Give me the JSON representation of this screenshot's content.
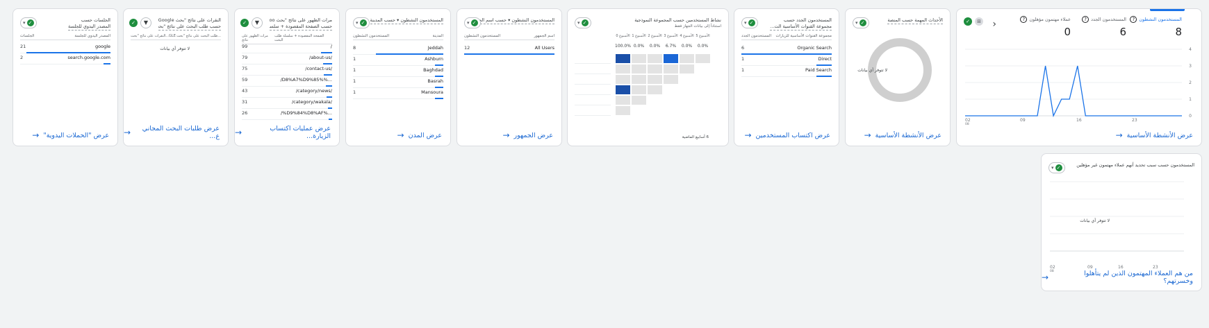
{
  "colors": {
    "accent": "#1a73e8",
    "link": "#1967d2",
    "check": "#1e8e3e",
    "heat_dark": "#1a4fa8",
    "heat_mid": "#1a66d6",
    "heat_grey": "#e3e3e3"
  },
  "overview": {
    "kpis": [
      {
        "label": "المستخدمون النشطون",
        "value": "8"
      },
      {
        "label": "المستخدمون الجدد",
        "value": "6"
      },
      {
        "label": "عملاء مهتمون مؤهلون",
        "value": "0"
      }
    ],
    "nav_prev": "‹",
    "y_ticks": [
      "4",
      "3",
      "2",
      "1",
      "0"
    ],
    "x_ticks": [
      "02",
      "09",
      "16",
      "23"
    ],
    "x_sub": "08",
    "chart_data": {
      "type": "line",
      "x": [
        "02",
        "03",
        "04",
        "05",
        "06",
        "07",
        "08",
        "09",
        "10",
        "11",
        "12",
        "13",
        "14",
        "15",
        "16",
        "17",
        "18",
        "19",
        "20",
        "21",
        "22",
        "23",
        "24",
        "25",
        "26",
        "27",
        "28",
        "29"
      ],
      "series": [
        {
          "values": [
            0,
            0,
            0,
            0,
            0,
            0,
            0,
            0,
            0,
            0,
            3,
            0,
            1,
            1,
            3,
            0,
            0,
            0,
            0,
            0,
            0,
            0,
            0,
            0,
            0,
            0,
            0,
            0
          ]
        }
      ],
      "ylim": [
        0,
        4
      ]
    },
    "footer_link": "عرض الأنشطة الأساسية"
  },
  "key_events": {
    "title": "الأحداث المهمة حسب المنصة",
    "nodata": "لا تتوفر أي بيانات",
    "footer_link": "عرض الأنشطة الأساسية"
  },
  "acquisition": {
    "title_1": "المستخدمون الجدد حسب",
    "title_2": "مجموعة القنوات الأساسية الت...",
    "col_left": "المستخدمون الجدد",
    "col_right": "مجموعة القنوات الأساسية للزيارات",
    "rows": [
      {
        "label": "Organic Search",
        "value": "6",
        "bar": 1.0
      },
      {
        "label": "Direct",
        "value": "1",
        "bar": 0.17
      },
      {
        "label": "Paid Search",
        "value": "1",
        "bar": 0.17
      }
    ],
    "footer_link": "عرض اكتساب المستخدمين"
  },
  "cohort": {
    "title": "نشاط المستخدمين حسب المجموعة النموذجية",
    "sub": "استناداً إلى بيانات الجهاز فقط",
    "headers": [
      "الأسبوع 0",
      "الأسبوع 1",
      "الأسبوع 2",
      "الأسبوع 3",
      "الأسبوع 4",
      "الأسبوع 5"
    ],
    "percents": [
      "100.0%",
      "0.0%",
      "0.0%",
      "6.7%",
      "0.0%",
      "0.0%"
    ],
    "foot_text": "6 أسابيع الماضية",
    "footer_link": ""
  },
  "audience": {
    "title": "المستخدمون النشطون ▾ حسب اسم الجمهور",
    "col_left": "المستخدمون النشطون",
    "col_right": "اسم الجمهور",
    "rows": [
      {
        "label": "All Users",
        "value": "12",
        "bar": 1.0
      }
    ],
    "footer_link": "عرض الجمهور"
  },
  "cities": {
    "title": "المستخدمون النشطون ▾ حسب المدينة",
    "col_left": "المستخدمون النشطون",
    "col_right": "المدينة",
    "rows": [
      {
        "label": "Jeddah",
        "value": "8",
        "bar": 0.8
      },
      {
        "label": "Ashburn",
        "value": "1",
        "bar": 0.1
      },
      {
        "label": "Baghdad",
        "value": "1",
        "bar": 0.1
      },
      {
        "label": "Basrah",
        "value": "1",
        "bar": 0.1
      },
      {
        "label": "Mansoura",
        "value": "1",
        "bar": 0.1
      }
    ],
    "footer_link": "عرض المدن"
  },
  "pages": {
    "title_1": "مرات الظهور على نتائج \"بحث Goo...",
    "title_2": "حسب الصفحة المقصودة + سلسلة ...",
    "col_left": "مرات الظهور على نتائج",
    "col_right": "الصفحة المقصودة + سلسلة طلب البحث",
    "rows": [
      {
        "label": "/",
        "value": "99",
        "bar": 0.12
      },
      {
        "label": "/about-us/",
        "value": "79",
        "bar": 0.1
      },
      {
        "label": "/contact-us/",
        "value": "75",
        "bar": 0.09
      },
      {
        "label": "...%D8%A7%D9%85%/",
        "value": "59",
        "bar": 0.07
      },
      {
        "label": "/category/news/",
        "value": "43",
        "bar": 0.06
      },
      {
        "label": "/category/wakala/",
        "value": "31",
        "bar": 0.05
      },
      {
        "label": "...%D9%84%D8%AF%/",
        "value": "26",
        "bar": 0.04
      }
    ],
    "footer_link": "عرض عمليات اكتساب الزيارة..."
  },
  "queries": {
    "title_1": "النقرات على نتائج \"بحث Google\"...",
    "title_2": "حسب طلب البحث على نتائج \"بحث Goo...",
    "col_left": "النقرات على نتائج \"بحث...GLE",
    "col_right": "طلب البحث على نتائج \"بحث...",
    "nodata": "لا تتوفر أي بيانات",
    "footer_link": "عرض طلبات البحث المجاني ع..."
  },
  "campaigns": {
    "title_1": "الجلسات حسب",
    "title_2": "المصدر اليدوي للجلسة",
    "col_left": "الجلسات",
    "col_right": "المصدر اليدوي للجلسة",
    "rows": [
      {
        "label": "google",
        "value": "21",
        "bar": 0.95
      },
      {
        "label": "search.google.com",
        "value": "2",
        "bar": 0.09
      }
    ],
    "footer_link": "عرض \"الحملات اليدوية\""
  },
  "leads": {
    "title": "المستخدمون حسب سبب تحديد أنهم عملاء مهتمون غير مؤهلين",
    "nodata": "لا تتوفر أي بيانات",
    "x_ticks": [
      "02",
      "09",
      "16",
      "23"
    ],
    "x_sub": "08",
    "footer_link": "من هم العملاء المهتمون الذين لم يتأهلوا وخسرتهم؟"
  }
}
